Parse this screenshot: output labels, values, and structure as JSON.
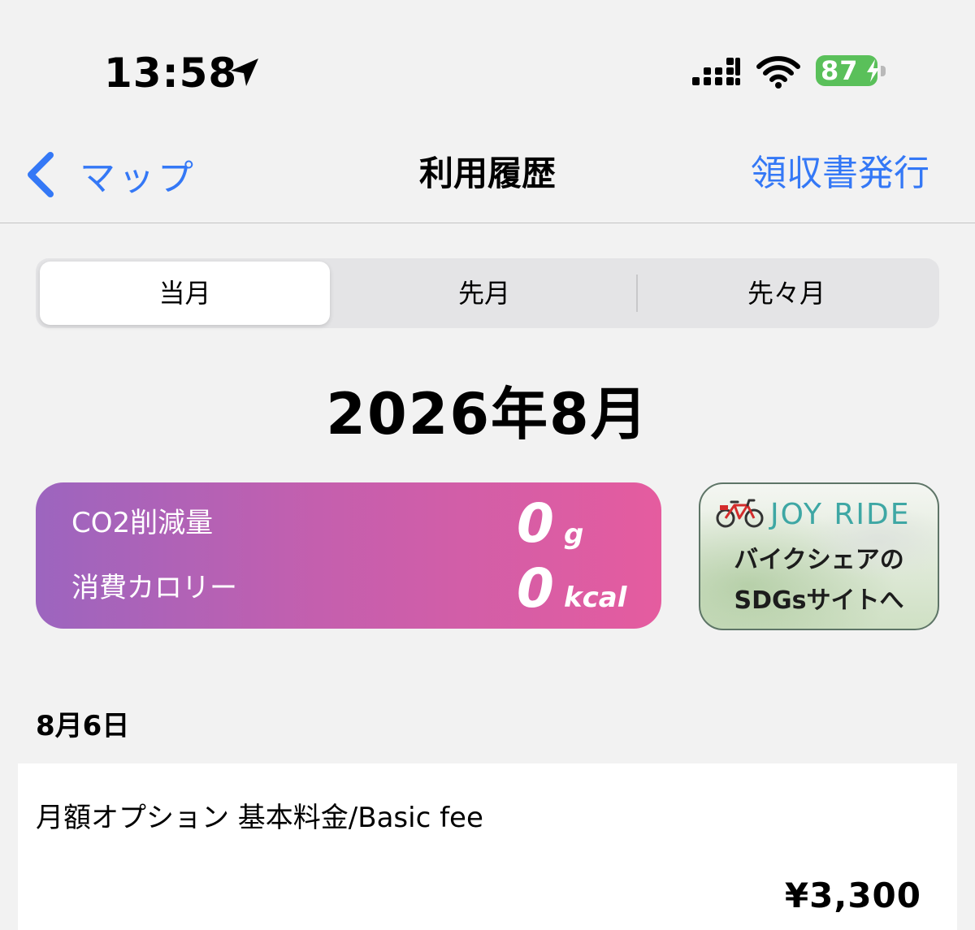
{
  "status_bar": {
    "time": "13:58",
    "battery_level": "87",
    "battery_color": "#5ac05a",
    "icons": [
      "location-arrow-icon",
      "cellular-signal-icon",
      "wifi-icon",
      "battery-charging-icon"
    ]
  },
  "nav": {
    "back_label": "マップ",
    "title": "利用履歴",
    "action_label": "領収書発行",
    "accent_color": "#3478f6"
  },
  "segments": [
    {
      "label": "当月",
      "selected": true
    },
    {
      "label": "先月",
      "selected": false
    },
    {
      "label": "先々月",
      "selected": false
    }
  ],
  "month_heading": "2026年8月",
  "stats": {
    "co2_label": "CO2削減量",
    "co2_value": "0",
    "co2_unit": "g",
    "calorie_label": "消費カロリー",
    "calorie_value": "0",
    "calorie_unit": "kcal",
    "gradient_colors": [
      "#9c65bf",
      "#e55c9f"
    ]
  },
  "banner": {
    "logo": "JOY RIDE",
    "line1": "バイクシェアの",
    "line2": "SDGsサイトへ",
    "logo_color": "#3ea7a4"
  },
  "history": {
    "date": "8月6日",
    "items": [
      {
        "title": "月額オプション 基本料金/Basic fee",
        "amount": "¥3,300"
      }
    ]
  }
}
